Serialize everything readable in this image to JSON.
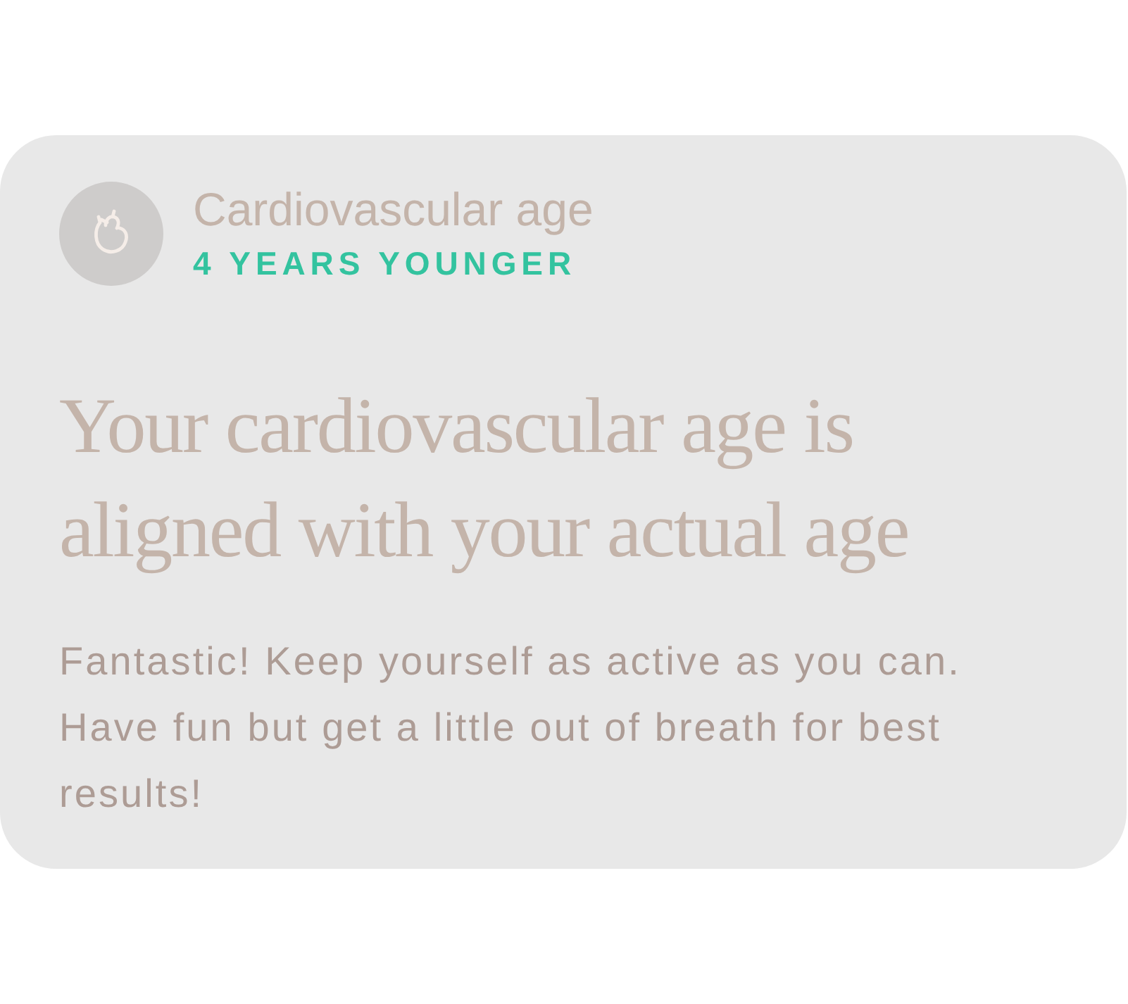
{
  "card": {
    "title": "Cardiovascular age",
    "status": "4 YEARS YOUNGER",
    "heading": "Your cardiovascular age is aligned with your actual age",
    "description": "Fantastic! Keep yourself as active as you can. Have fun but get a little out of breath for best results!"
  }
}
